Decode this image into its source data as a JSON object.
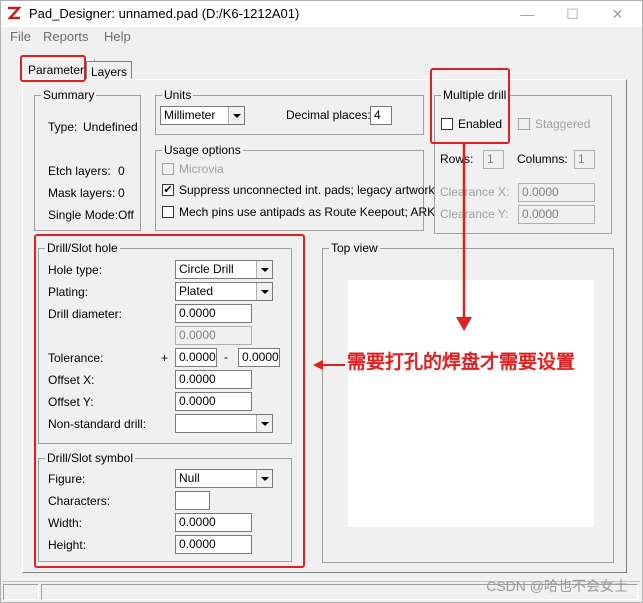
{
  "window": {
    "title": "Pad_Designer: unnamed.pad (D:/K6-1212A01)"
  },
  "menu": [
    "File",
    "Reports",
    "Help"
  ],
  "tabs": [
    {
      "label": "Parameters",
      "active": true
    },
    {
      "label": "Layers",
      "active": false
    }
  ],
  "summary": {
    "title": "Summary",
    "type_label": "Type:",
    "type_value": "Undefined",
    "etch_label": "Etch layers:",
    "etch_value": "0",
    "mask_label": "Mask layers:",
    "mask_value": "0",
    "single_label": "Single Mode:",
    "single_value": "Off"
  },
  "units": {
    "title": "Units",
    "unit_value": "Millimeter",
    "decimal_label": "Decimal places:",
    "decimal_value": "4"
  },
  "usage": {
    "title": "Usage options",
    "microvia": "Microvia",
    "suppress": "Suppress unconnected int. pads; legacy artwork",
    "suppress_checked": "✔",
    "mech": "Mech pins use antipads as Route Keepout; ARK"
  },
  "multiple_drill": {
    "title": "Multiple drill",
    "enabled": "Enabled",
    "staggered": "Staggered",
    "rows_label": "Rows:",
    "rows_value": "1",
    "columns_label": "Columns:",
    "columns_value": "1",
    "clearance_x_label": "Clearance X:",
    "clearance_x_value": "0.0000",
    "clearance_y_label": "Clearance Y:",
    "clearance_y_value": "0.0000"
  },
  "drill": {
    "title": "Drill/Slot hole",
    "hole_type_label": "Hole type:",
    "hole_type_value": "Circle Drill",
    "plating_label": "Plating:",
    "plating_value": "Plated",
    "diameter_label": "Drill diameter:",
    "diameter_value": "0.0000",
    "diameter_value2": "0.0000",
    "tolerance_label": "Tolerance:",
    "tol_plus": "+",
    "tol_plus_value": "0.0000",
    "tol_minus": "-",
    "tol_minus_value": "0.0000",
    "offset_x_label": "Offset X:",
    "offset_x_value": "0.0000",
    "offset_y_label": "Offset Y:",
    "offset_y_value": "0.0000",
    "nonstd_label": "Non-standard drill:",
    "nonstd_value": ""
  },
  "symbol": {
    "title": "Drill/Slot symbol",
    "figure_label": "Figure:",
    "figure_value": "Null",
    "characters_label": "Characters:",
    "characters_value": "",
    "width_label": "Width:",
    "width_value": "0.0000",
    "height_label": "Height:",
    "height_value": "0.0000"
  },
  "top_view": {
    "title": "Top view"
  },
  "annotation": {
    "text": "需要打孔的焊盘才需要设置",
    "color": "#e02020"
  },
  "watermark": "CSDN @哈也不会女士"
}
